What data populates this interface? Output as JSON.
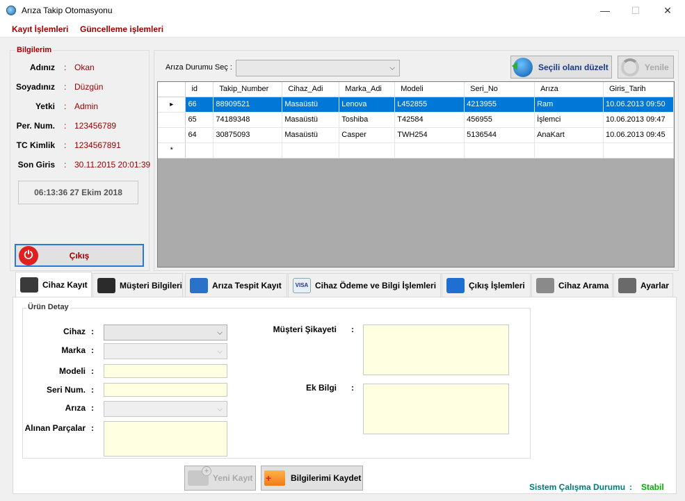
{
  "window": {
    "title": "Arıza Takip Otomasyonu",
    "minimize": "—",
    "maximize": "☐",
    "close": "✕"
  },
  "menu": {
    "items": [
      "Kayıt İşlemleri",
      "Güncelleme işlemleri"
    ]
  },
  "bilgilerim": {
    "title": "Bilgilerim",
    "rows": [
      {
        "label": "Adınız",
        "value": "Okan"
      },
      {
        "label": "Soyadınız",
        "value": "Düzgün"
      },
      {
        "label": "Yetki",
        "value": "Admin"
      },
      {
        "label": "Per. Num.",
        "value": "123456789"
      },
      {
        "label": "TC Kimlik",
        "value": "1234567891"
      },
      {
        "label": "Son Giris",
        "value": "30.11.2015 20:01:39"
      }
    ],
    "colon": ":",
    "clock": "06:13:36 27 Ekim 2018",
    "exit_label": "Çıkış"
  },
  "filter": {
    "label": "Arıza Durumu Seç :",
    "selected": ""
  },
  "actions": {
    "edit_label": "Seçili olanı düzelt",
    "refresh_label": "Yenile"
  },
  "grid": {
    "columns": [
      "id",
      "Takip_Number",
      "Cihaz_Adi",
      "Marka_Adi",
      "Modeli",
      "Seri_No",
      "Arıza",
      "Giris_Tarih"
    ],
    "rows": [
      [
        "66",
        "88909521",
        "Masaüstü",
        "Lenova",
        "L452855",
        "4213955",
        "Ram",
        "10.06.2013 09:50"
      ],
      [
        "65",
        "74189348",
        "Masaüstü",
        "Toshiba",
        "T42584",
        "456955",
        "İşlemci",
        "10.06.2013 09:47"
      ],
      [
        "64",
        "30875093",
        "Masaüstü",
        "Casper",
        "TWH254",
        "5136544",
        "AnaKart",
        "10.06.2013 09:45"
      ]
    ],
    "selected_marker": "▸",
    "new_row_marker": "*"
  },
  "tabs": [
    {
      "label": "Cihaz Kayıt",
      "icon": "monitor-icon",
      "color": "#3a3a3a"
    },
    {
      "label": "Müşteri Bilgileri",
      "icon": "user-icon",
      "color": "#2b2b2b"
    },
    {
      "label": "Arıza Tespit Kayıt",
      "icon": "pin-icon",
      "color": "#2a72c9"
    },
    {
      "label": "Cihaz Ödeme ve Bilgi İşlemleri",
      "icon": "visa-card-icon",
      "color": "#1a4fa0"
    },
    {
      "label": "Çıkış İşlemleri",
      "icon": "exit-door-icon",
      "color": "#1f6fd0"
    },
    {
      "label": "Cihaz Arama",
      "icon": "folder-search-icon",
      "color": "#8a8a8a"
    },
    {
      "label": "Ayarlar",
      "icon": "gear-icon",
      "color": "#6a6a6a"
    }
  ],
  "form": {
    "group_title": "Ürün Detay",
    "fields": [
      {
        "label": "Cihaz",
        "type": "combo",
        "value": ""
      },
      {
        "label": "Marka",
        "type": "combo-disabled",
        "value": ""
      },
      {
        "label": "Modeli",
        "type": "text",
        "value": ""
      },
      {
        "label": "Seri Num.",
        "type": "text",
        "value": ""
      },
      {
        "label": "Arıza",
        "type": "combo-disabled",
        "value": ""
      },
      {
        "label": "Alınan Parçalar",
        "type": "textarea",
        "value": ""
      }
    ],
    "complaint_label": "Müşteri Şikayeti",
    "extra_label": "Ek Bilgi",
    "colon": ":",
    "new_record_label": "Yeni Kayıt",
    "save_label": "Bilgilerimi Kaydet"
  },
  "status": {
    "label": "Sistem Çalışma Durumu",
    "colon": ":",
    "value": "Stabil"
  }
}
